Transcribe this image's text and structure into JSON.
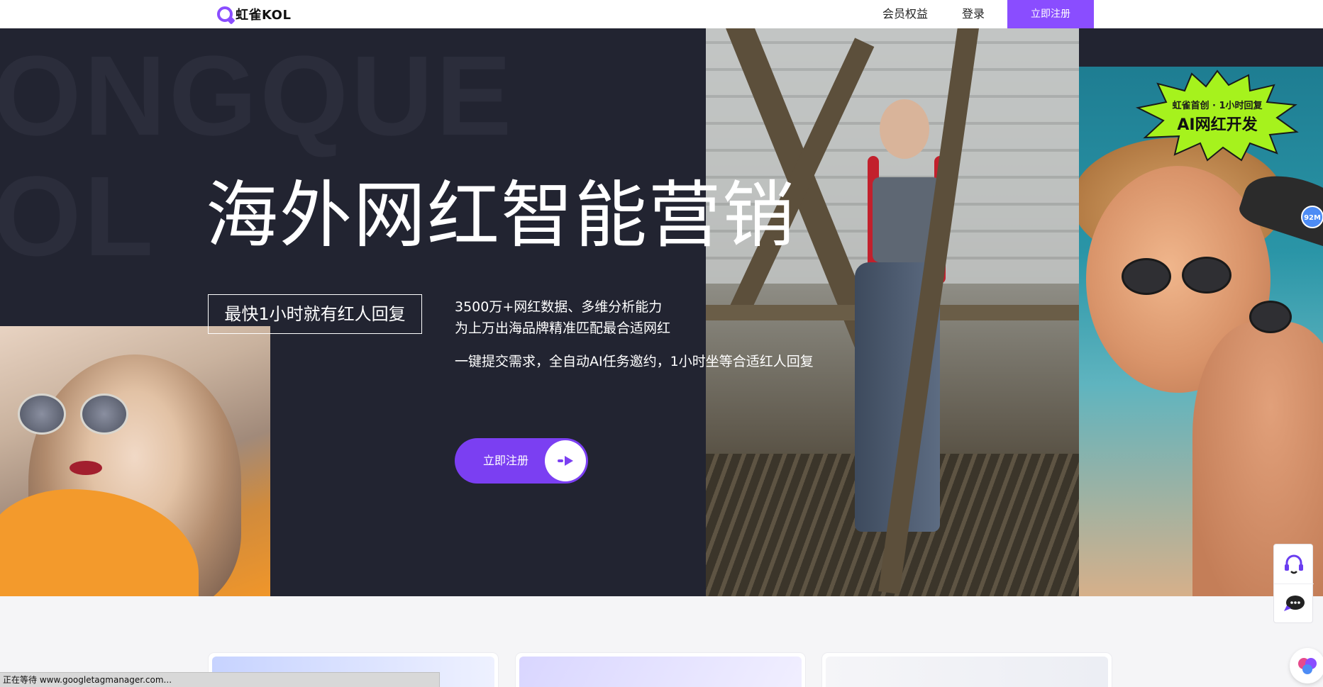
{
  "header": {
    "logo_text": "虹雀KOL",
    "nav_member": "会员权益",
    "nav_login": "登录",
    "nav_register": "立即注册"
  },
  "hero": {
    "bg_letters_row1": "ONGQUE",
    "bg_letters_row2": "OL",
    "title": "海外网红智能营销",
    "tag": "最快1小时就有红人回复",
    "desc_line1": "3500万+网红数据、多维分析能力",
    "desc_line2": "为上万出海品牌精准匹配最合适网红",
    "desc_line3": "一键提交需求，全自动AI任务邀约，1小时坐等合适红人回复",
    "cta_label": "立即注册"
  },
  "promo_badge": {
    "small_text": "虹雀首创 · 1小时回复",
    "big_text": "AI网红开发",
    "color": "#a6f21d"
  },
  "side_badge": {
    "text": "92M"
  },
  "float_tools": {
    "support_icon": "headset-icon",
    "chat_icon": "chat-bubble-icon"
  },
  "status_bar": {
    "text": "正在等待 www.googletagmanager.com..."
  },
  "colors": {
    "accent": "#8a4dff",
    "cta": "#7b3ff2",
    "hero_bg": "#222431"
  }
}
